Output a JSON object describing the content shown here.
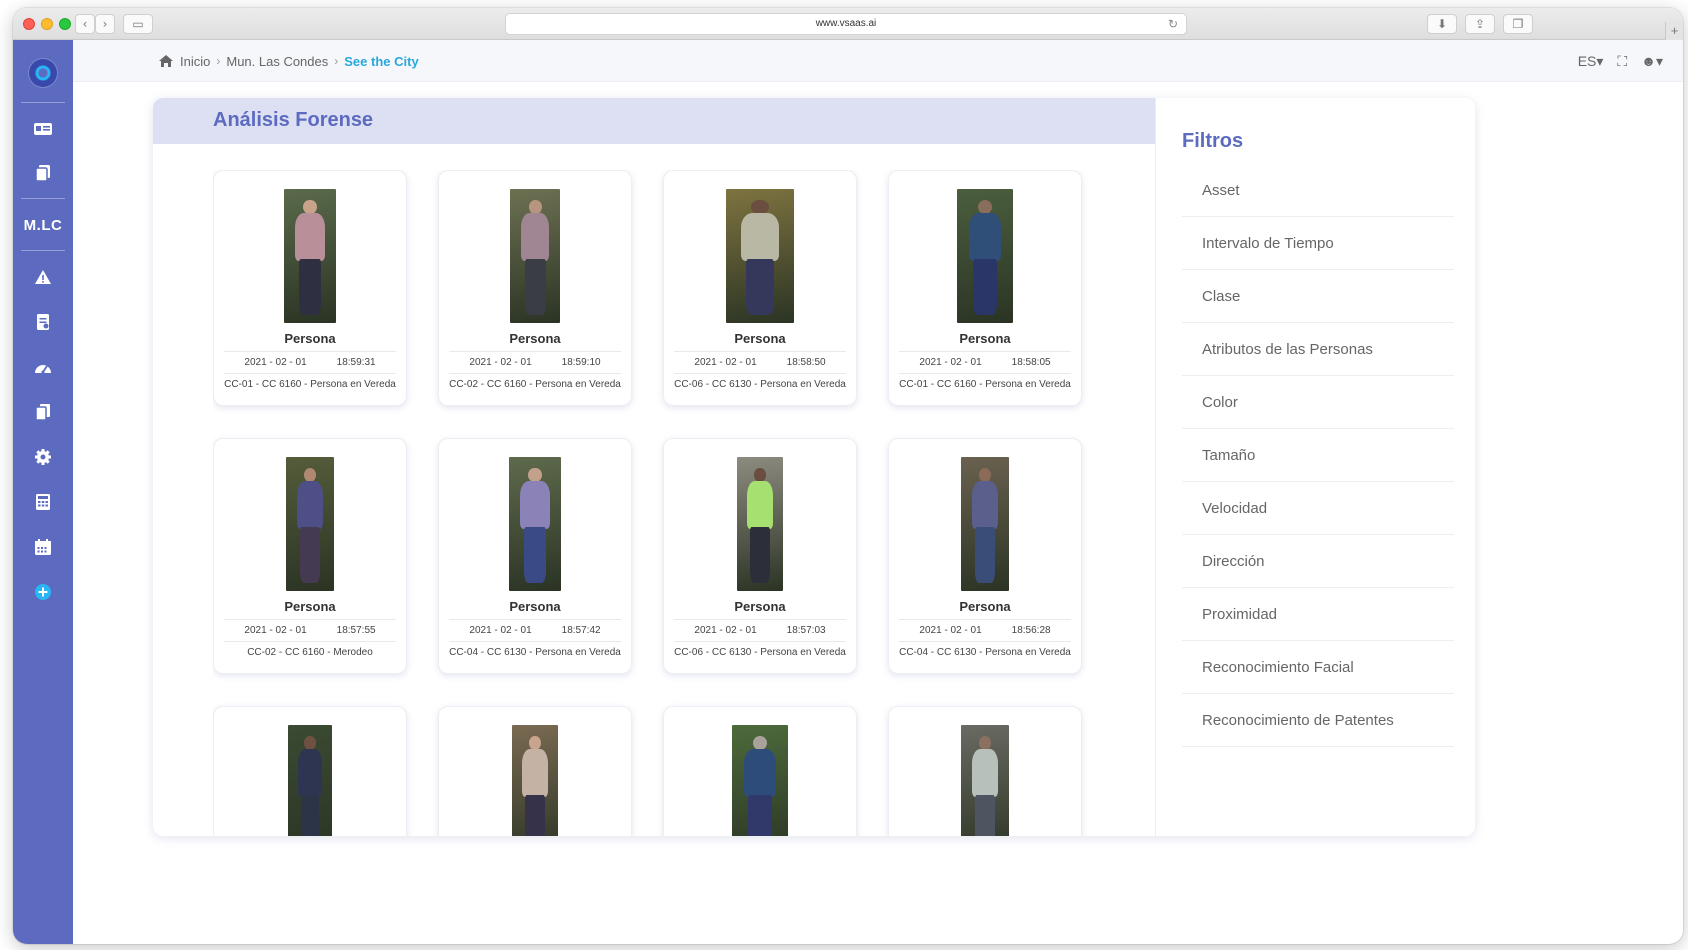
{
  "browser": {
    "url": "www.vsaas.ai",
    "reload_icon": "reload-icon",
    "plus_label": "+"
  },
  "sidebar": {
    "logo_icon": "vsaas-logo",
    "brand_label": "M.LC",
    "icons": [
      "id-card-icon",
      "copy-icon",
      "warning-icon",
      "report-icon",
      "dashboard-icon",
      "document-icon",
      "gear-icon",
      "calculator-icon",
      "calendar-icon",
      "add-circle-icon"
    ]
  },
  "breadcrumb": {
    "home": "Inicio",
    "level2": "Mun. Las Condes",
    "current": "See the City"
  },
  "header_right": {
    "language": "ES▾",
    "fullscreen": "⛶",
    "user": "☻▾"
  },
  "panel": {
    "title": "Análisis Forense"
  },
  "cards": [
    {
      "label": "Persona",
      "date": "2021 - 02 - 01",
      "time": "18:59:31",
      "camera": "CC-01 - CC 6160 - Persona en Vereda",
      "bg": "#5a6a4a",
      "top": "#b98f9a",
      "bottom": "#2e3042",
      "skin": "#c7a38c"
    },
    {
      "label": "Persona",
      "date": "2021 - 02 - 01",
      "time": "18:59:10",
      "camera": "CC-02 - CC 6160 - Persona en Vereda",
      "bg": "#6d7152",
      "top": "#a08592",
      "bottom": "#3b3d46",
      "skin": "#b89580"
    },
    {
      "label": "Persona",
      "date": "2021 - 02 - 01",
      "time": "18:58:50",
      "camera": "CC-06 - CC 6130 - Persona en Vereda",
      "bg": "#7e7340",
      "top": "#b9b8a5",
      "bottom": "#35385a",
      "skin": "#6b4e3f"
    },
    {
      "label": "Persona",
      "date": "2021 - 02 - 01",
      "time": "18:58:05",
      "camera": "CC-01 - CC 6160 - Persona en Vereda",
      "bg": "#4b5e3e",
      "top": "#2f4f78",
      "bottom": "#2b3668",
      "skin": "#8a6e5c"
    },
    {
      "label": "Persona",
      "date": "2021 - 02 - 01",
      "time": "18:57:55",
      "camera": "CC-02 - CC 6160 - Merodeo",
      "bg": "#545c3a",
      "top": "#4e4f86",
      "bottom": "#443a52",
      "skin": "#b08872"
    },
    {
      "label": "Persona",
      "date": "2021 - 02 - 01",
      "time": "18:57:42",
      "camera": "CC-04 - CC 6130 - Persona en Vereda",
      "bg": "#5e6a4c",
      "top": "#8b82b8",
      "bottom": "#3a4a86",
      "skin": "#c2a08c"
    },
    {
      "label": "Persona",
      "date": "2021 - 02 - 01",
      "time": "18:57:03",
      "camera": "CC-06 - CC 6130 - Persona en Vereda",
      "bg": "#8d8b80",
      "top": "#a6e070",
      "bottom": "#2c2f3a",
      "skin": "#6a4d3e"
    },
    {
      "label": "Persona",
      "date": "2021 - 02 - 01",
      "time": "18:56:28",
      "camera": "CC-04 - CC 6130 - Persona en Vereda",
      "bg": "#6a6150",
      "top": "#5a5f8c",
      "bottom": "#3a4d78",
      "skin": "#8b6a57"
    },
    {
      "label": "",
      "date": "",
      "time": "",
      "camera": "",
      "bg": "#3b4a33",
      "top": "#2e3550",
      "bottom": "#2c3548",
      "skin": "#6e5140"
    },
    {
      "label": "",
      "date": "",
      "time": "",
      "camera": "",
      "bg": "#7a6a52",
      "top": "#c4b2a5",
      "bottom": "#35324a",
      "skin": "#c8a48e"
    },
    {
      "label": "",
      "date": "",
      "time": "",
      "camera": "",
      "bg": "#4d6a3c",
      "top": "#2d4c7a",
      "bottom": "#30396a",
      "skin": "#a9a29a"
    },
    {
      "label": "",
      "date": "",
      "time": "",
      "camera": "",
      "bg": "#6a6a62",
      "top": "#b8c0bc",
      "bottom": "#4e5460",
      "skin": "#8a7060"
    }
  ],
  "filters": {
    "title": "Filtros",
    "items": [
      "Asset",
      "Intervalo de Tiempo",
      "Clase",
      "Atributos de las Personas",
      "Color",
      "Tamaño",
      "Velocidad",
      "Dirección",
      "Proximidad",
      "Reconocimiento Facial",
      "Reconocimiento de Patentes"
    ]
  }
}
